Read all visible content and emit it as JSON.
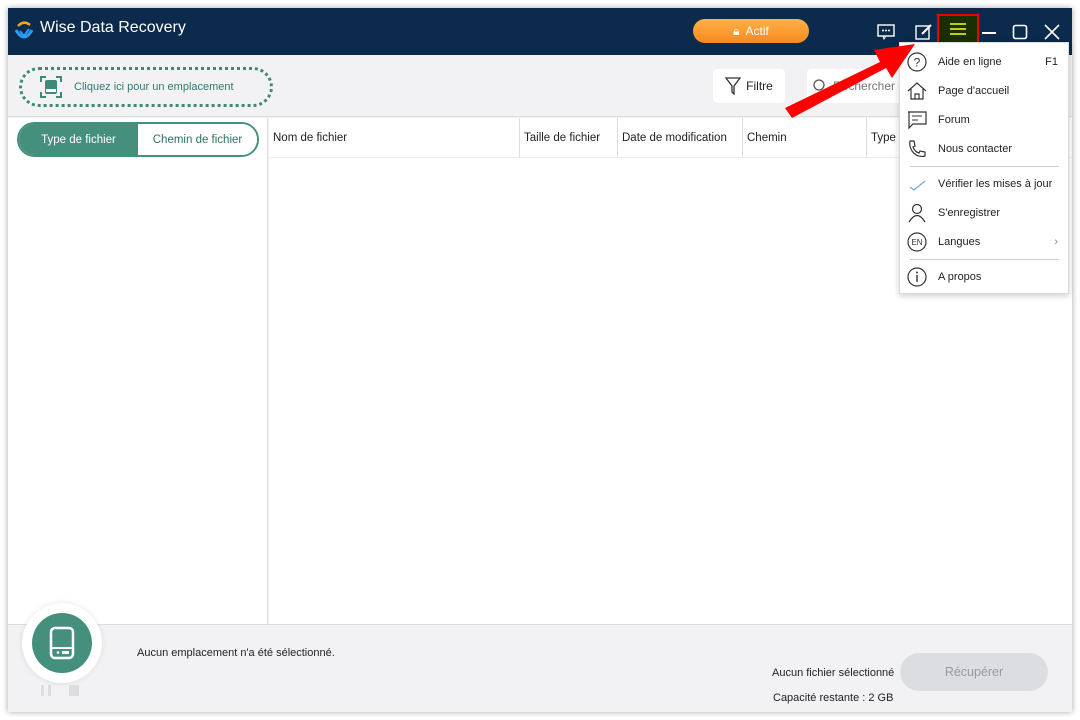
{
  "app": {
    "title": "Wise Data Recovery",
    "actif_label": "Actif"
  },
  "toolbar": {
    "location_label": "Cliquez ici pour un emplacement",
    "filter_label": "Filtre",
    "search_placeholder": "Rechercher des fichiers"
  },
  "left": {
    "tabs": [
      {
        "label": "Type de fichier",
        "active": true
      },
      {
        "label": "Chemin de fichier",
        "active": false
      }
    ]
  },
  "table": {
    "columns": [
      "Nom de fichier",
      "Taille de fichier",
      "Date de modification",
      "Chemin",
      "Type"
    ]
  },
  "bottom": {
    "status": "Aucun emplacement n'a été sélectionné.",
    "no_file": "Aucun fichier sélectionné",
    "capacity": "Capacité restante : 2 GB",
    "recover_label": "Récupérer"
  },
  "menu": {
    "items": [
      {
        "label": "Aide en ligne",
        "shortcut": "F1",
        "icon": "help-icon"
      },
      {
        "label": "Page d'accueil",
        "icon": "home-icon"
      },
      {
        "label": "Forum",
        "icon": "forum-icon"
      },
      {
        "label": "Nous contacter",
        "icon": "phone-icon"
      },
      {
        "label": "Vérifier les mises à jour",
        "icon": "check-icon"
      },
      {
        "label": "S'enregistrer",
        "icon": "user-icon"
      },
      {
        "label": "Langues",
        "icon": "language-icon",
        "icon_text": "EN"
      },
      {
        "label": "A propos",
        "icon": "info-icon"
      }
    ]
  },
  "colors": {
    "titlebar": "#0b2a4c",
    "accent": "#45907c",
    "actif": "#f58a1f",
    "highlight": "#e00000"
  }
}
